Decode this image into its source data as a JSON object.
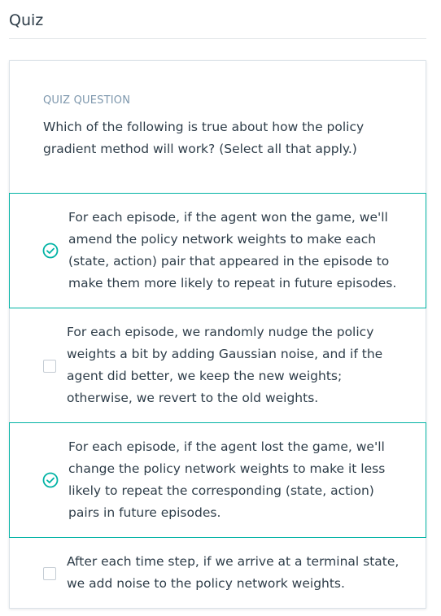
{
  "page": {
    "title": "Quiz"
  },
  "quiz": {
    "eyebrow": "QUIZ QUESTION",
    "question": "Which of the following is true about how the policy gradient method will work? (Select all that apply.)",
    "accent_color": "#02b3a5",
    "options": [
      {
        "text": "For each episode, if the agent won the game, we'll amend the policy network weights to make each (state, action) pair that appeared in the episode to make them more likely to repeat in future episodes.",
        "selected": true,
        "icon": "check-circle-icon"
      },
      {
        "text": "For each episode, we randomly nudge the policy weights a bit by adding Gaussian noise, and if the agent did better, we keep the new weights; otherwise, we revert to the old weights.",
        "selected": false,
        "icon": "checkbox-icon"
      },
      {
        "text": "For each episode, if the agent lost the game, we'll change the policy network weights to make it less likely to repeat the corresponding (state, action) pairs in future episodes.",
        "selected": true,
        "icon": "check-circle-icon"
      },
      {
        "text": "After each time step, if we arrive at a terminal state, we add noise to the policy network weights.",
        "selected": false,
        "icon": "checkbox-icon"
      }
    ]
  }
}
